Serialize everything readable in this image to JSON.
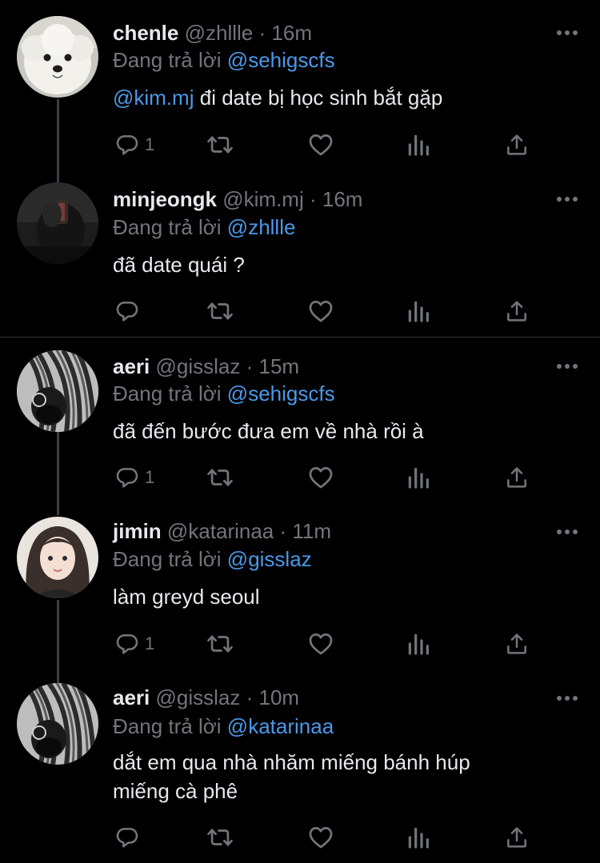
{
  "colors": {
    "background": "#000000",
    "text": "#e7e9ea",
    "muted": "#71767b",
    "link": "#4a99e9",
    "thread_line": "#3a3d41"
  },
  "icons": [
    "more-icon",
    "reply-icon",
    "retweet-icon",
    "like-icon",
    "analytics-icon",
    "share-icon"
  ],
  "tweets": [
    {
      "name": "chenle",
      "handle": "@zhllle",
      "time": "16m",
      "replying_prefix": "Đang trả lời",
      "replying_to": "@sehigscfs",
      "mention": "@kim.mj",
      "text": "đi date bị học sinh bắt gặp",
      "reply_count": "1"
    },
    {
      "name": "minjeongk",
      "handle": "@kim.mj",
      "time": "16m",
      "replying_prefix": "Đang trả lời",
      "replying_to": "@zhllle",
      "text": "đã date quái ?",
      "reply_count": ""
    },
    {
      "name": "aeri",
      "handle": "@gisslaz",
      "time": "15m",
      "replying_prefix": "Đang trả lời",
      "replying_to": "@sehigscfs",
      "text": "đã đến bước đưa em về nhà rồi à",
      "reply_count": "1"
    },
    {
      "name": "jimin",
      "handle": "@katarinaa",
      "time": "11m",
      "replying_prefix": "Đang trả lời",
      "replying_to": "@gisslaz",
      "text": "làm greyd seoul",
      "reply_count": "1"
    },
    {
      "name": "aeri",
      "handle": "@gisslaz",
      "time": "10m",
      "replying_prefix": "Đang trả lời",
      "replying_to": "@katarinaa",
      "text_line1": "dắt em qua nhà nhăm miếng bánh húp",
      "text_line2": "miếng cà phê",
      "reply_count": ""
    }
  ]
}
